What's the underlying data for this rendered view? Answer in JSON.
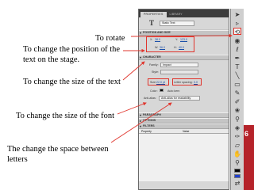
{
  "annotations": {
    "rotate": "To rotate",
    "position": [
      "To change the position of the",
      "text on the stage."
    ],
    "size_text": "To change the size of the text",
    "size_font": "To change the size of the font",
    "spacing": [
      "The change the space between",
      "letters"
    ]
  },
  "panel": {
    "tabs": [
      "PROPERTIES",
      "LIBRARY"
    ],
    "text_type": "Static Text",
    "sections": {
      "position_size": "POSITION AND SIZE",
      "character": "CHARACTER",
      "paragraph": "PARAGRAPH",
      "options": "OPTIONS",
      "filters": "FILTERS"
    },
    "x_label": "X:",
    "x_value": "38.0",
    "y_label": "Y:",
    "y_value": "123.0",
    "w_label": "W:",
    "w_value": "36.0",
    "h_label": "H:",
    "h_value": "40.0",
    "family_label": "Family:",
    "family_value": "Impact",
    "style_label": "Style:",
    "size_label": "Size:",
    "size_value": "22.0 pt",
    "letter_spacing_label": "Letter spacing:",
    "letter_spacing_value": "0.0",
    "color_label": "Color:",
    "auto_kern": "Auto kern",
    "anti_alias_label": "Anti-alias:",
    "anti_alias_value": "Anti-alias for readability",
    "filters_columns": [
      "Property",
      "Value"
    ]
  },
  "slide_number": "6",
  "colors": {
    "highlight": "#e0342c",
    "slide_badge": "#b5232a",
    "tab_bar": "#3c3c3c"
  }
}
